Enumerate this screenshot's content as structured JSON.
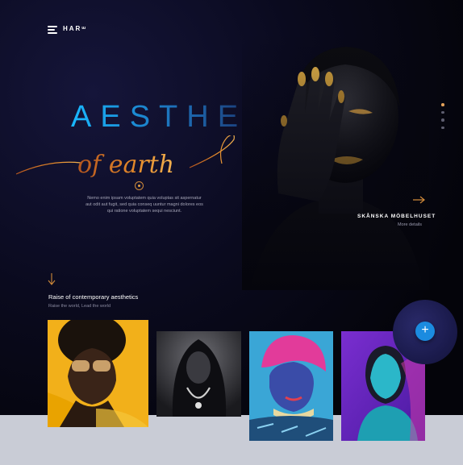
{
  "header": {
    "logo": "HARᵚ",
    "menu_icon": "hamburger-menu-icon"
  },
  "hero": {
    "headline": "AESTHE",
    "script_text": "of earth",
    "description": "Nemo enim ipsam voluptatem quia voluptas sit aspernatur aut odit aut fugit, sed quia conseq uuntur magni dolores eos qui ratione voluptatem sequi nesciunt."
  },
  "feature": {
    "brand": "SKÅNSKA MÖBELHUSET",
    "link": "More details"
  },
  "section": {
    "title": "Raise of contemporary aesthetics",
    "subtitle": "Raise the world, Lead the world"
  },
  "slider": {
    "count": 4,
    "active_index": 0
  },
  "colors": {
    "accent_blue": "#1b8be0",
    "accent_gold": "#e3a15a",
    "headline_blue": "#19b8ff",
    "background": "#05050c"
  },
  "icons": {
    "arrow_right": "arrow-right-icon",
    "arrow_down": "arrow-down-icon",
    "plus": "plus-icon"
  },
  "add_button_label": "+"
}
